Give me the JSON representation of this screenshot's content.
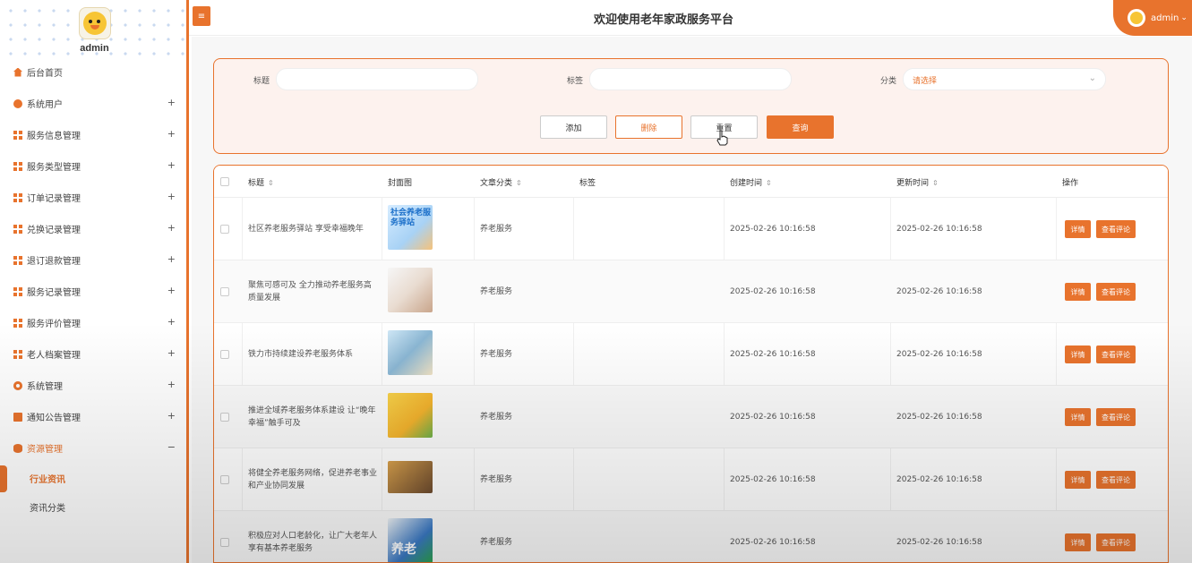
{
  "sidebar": {
    "username": "admin",
    "items": [
      {
        "label": "后台首页",
        "icon": "home-icon",
        "expand": ""
      },
      {
        "label": "系统用户",
        "icon": "user-icon",
        "expand": "+"
      },
      {
        "label": "服务信息管理",
        "icon": "grid-icon",
        "expand": "+"
      },
      {
        "label": "服务类型管理",
        "icon": "grid-icon",
        "expand": "+"
      },
      {
        "label": "订单记录管理",
        "icon": "grid-icon",
        "expand": "+"
      },
      {
        "label": "兑换记录管理",
        "icon": "grid-icon",
        "expand": "+"
      },
      {
        "label": "退订退款管理",
        "icon": "grid-icon",
        "expand": "+"
      },
      {
        "label": "服务记录管理",
        "icon": "grid-icon",
        "expand": "+"
      },
      {
        "label": "服务评价管理",
        "icon": "grid-icon",
        "expand": "+"
      },
      {
        "label": "老人档案管理",
        "icon": "grid-icon",
        "expand": "+"
      },
      {
        "label": "系统管理",
        "icon": "gear-icon",
        "expand": "+"
      },
      {
        "label": "通知公告管理",
        "icon": "document-icon",
        "expand": "+"
      },
      {
        "label": "资源管理",
        "icon": "database-icon",
        "expand": "−"
      }
    ],
    "sub_items": [
      {
        "label": "行业资讯"
      },
      {
        "label": "资讯分类"
      }
    ]
  },
  "header": {
    "title": "欢迎使用老年家政服务平台",
    "user": "admin",
    "user_caret": "⌄",
    "toggle_icon": "≡"
  },
  "search": {
    "title_label": "标题",
    "tag_label": "标签",
    "category_label": "分类",
    "category_placeholder": "请选择",
    "title_value": "",
    "tag_value": ""
  },
  "buttons": {
    "add": "添加",
    "delete": "删除",
    "reset": "重置",
    "query": "查询"
  },
  "table": {
    "headers": {
      "title": "标题",
      "cover": "封面图",
      "category": "文章分类",
      "tag": "标签",
      "created": "创建时间",
      "updated": "更新时间",
      "actions": "操作"
    },
    "sort_symbol": "⇕",
    "rows": [
      {
        "title": "社区养老服务驿站 享受幸福晚年",
        "category": "养老服务",
        "tag": "",
        "created": "2025-02-26 10:16:58",
        "updated": "2025-02-26 10:16:58",
        "cover_text": "社会养老服务驿站"
      },
      {
        "title": "聚焦可感可及 全力推动养老服务高质量发展",
        "category": "养老服务",
        "tag": "",
        "created": "2025-02-26 10:16:58",
        "updated": "2025-02-26 10:16:58"
      },
      {
        "title": "铁力市持续建设养老服务体系",
        "category": "养老服务",
        "tag": "",
        "created": "2025-02-26 10:16:58",
        "updated": "2025-02-26 10:16:58"
      },
      {
        "title": "推进全域养老服务体系建设 让“晚年幸福”触手可及",
        "category": "养老服务",
        "tag": "",
        "created": "2025-02-26 10:16:58",
        "updated": "2025-02-26 10:16:58"
      },
      {
        "title": "将健全养老服务网络，促进养老事业和产业协同发展",
        "category": "养老服务",
        "tag": "",
        "created": "2025-02-26 10:16:58",
        "updated": "2025-02-26 10:16:58"
      },
      {
        "title": "积极应对人口老龄化，让广大老年人享有基本养老服务",
        "category": "养老服务",
        "tag": "",
        "created": "2025-02-26 10:16:58",
        "updated": "2025-02-26 10:16:58",
        "cover_text": "养老"
      }
    ],
    "row_actions": {
      "detail": "详情",
      "comments": "查看评论"
    }
  },
  "colors": {
    "accent": "#e8732d",
    "panel_bg": "#fdf2ee"
  }
}
